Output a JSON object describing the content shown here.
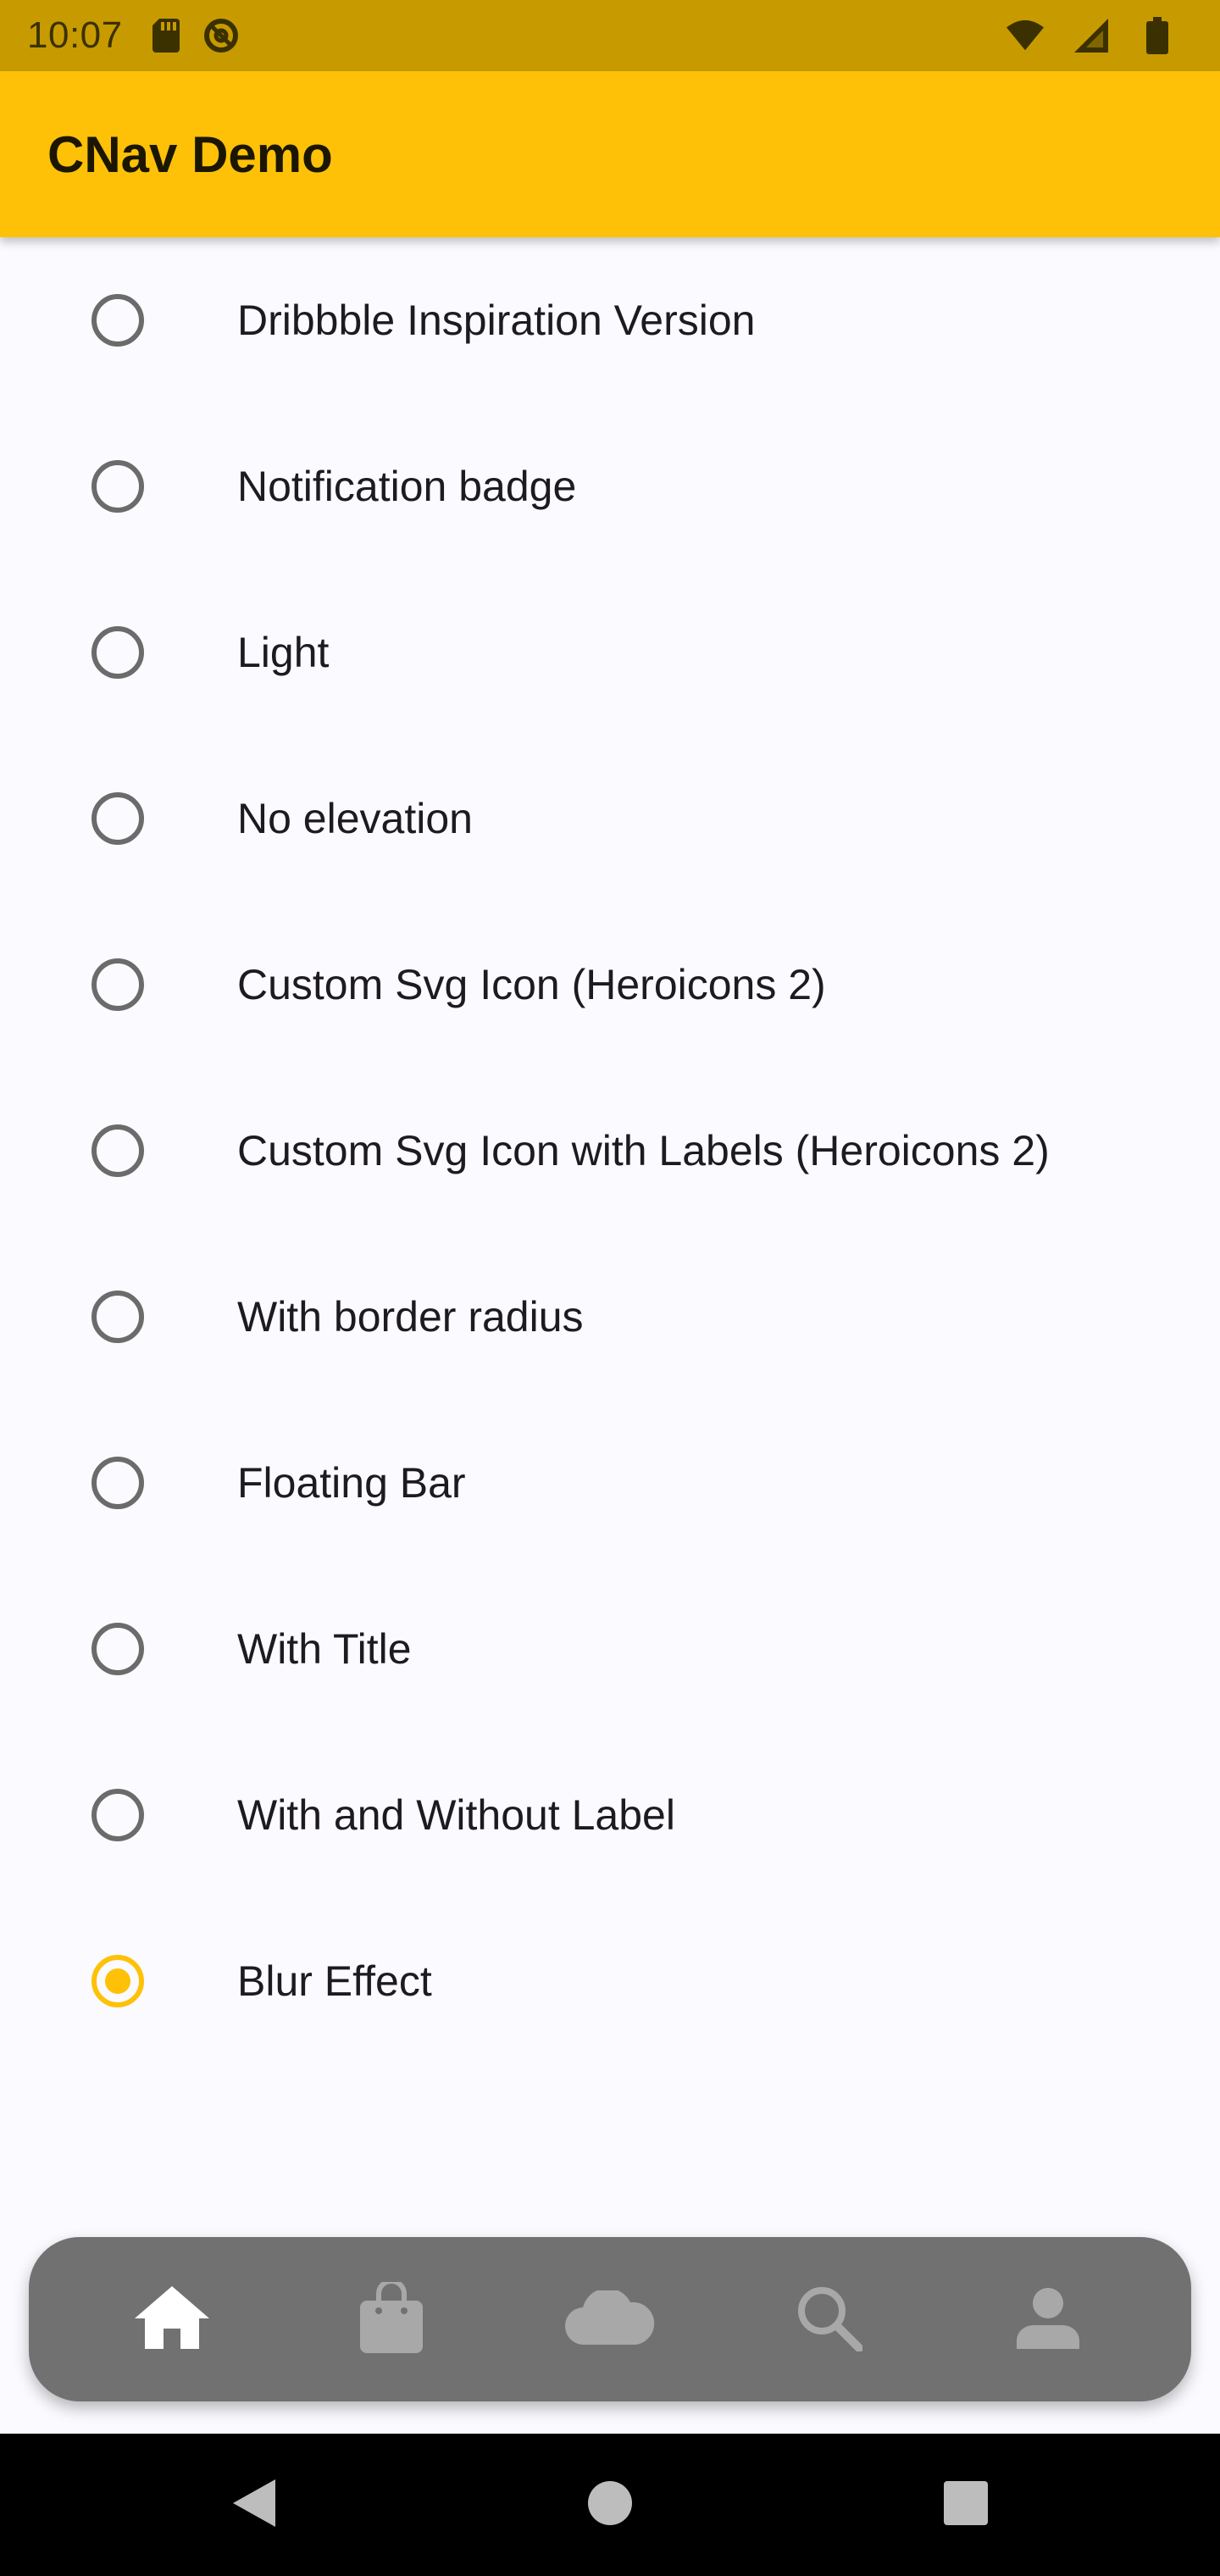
{
  "status_bar": {
    "time": "10:07",
    "icons": [
      "sd-card-icon",
      "no-disturb-icon",
      "wifi-icon",
      "cell-signal-icon",
      "battery-icon"
    ]
  },
  "app_bar": {
    "title": "CNav Demo"
  },
  "options": [
    {
      "label": "Dribbble Inspiration Version",
      "selected": false
    },
    {
      "label": "Notification badge",
      "selected": false
    },
    {
      "label": "Light",
      "selected": false
    },
    {
      "label": "No elevation",
      "selected": false
    },
    {
      "label": "Custom Svg Icon (Heroicons 2)",
      "selected": false
    },
    {
      "label": "Custom Svg Icon with Labels (Heroicons 2)",
      "selected": false
    },
    {
      "label": "With border radius",
      "selected": false
    },
    {
      "label": "Floating Bar",
      "selected": false
    },
    {
      "label": "With Title",
      "selected": false
    },
    {
      "label": "With and Without Label",
      "selected": false
    },
    {
      "label": "Blur Effect",
      "selected": true
    }
  ],
  "bottom_nav": {
    "items": [
      {
        "icon": "home-icon",
        "active": true
      },
      {
        "icon": "shopping-bag-icon",
        "active": false
      },
      {
        "icon": "cloud-icon",
        "active": false
      },
      {
        "icon": "search-icon",
        "active": false
      },
      {
        "icon": "person-icon",
        "active": false
      }
    ]
  },
  "system_nav": {
    "buttons": [
      "back-icon",
      "home-circle-icon",
      "recents-icon"
    ]
  },
  "colors": {
    "accent": "#fec107",
    "status_bar": "#c79b00",
    "background": "#fbfafe",
    "radio_unselected": "#6b6b6b",
    "bottom_nav": "#717171"
  }
}
